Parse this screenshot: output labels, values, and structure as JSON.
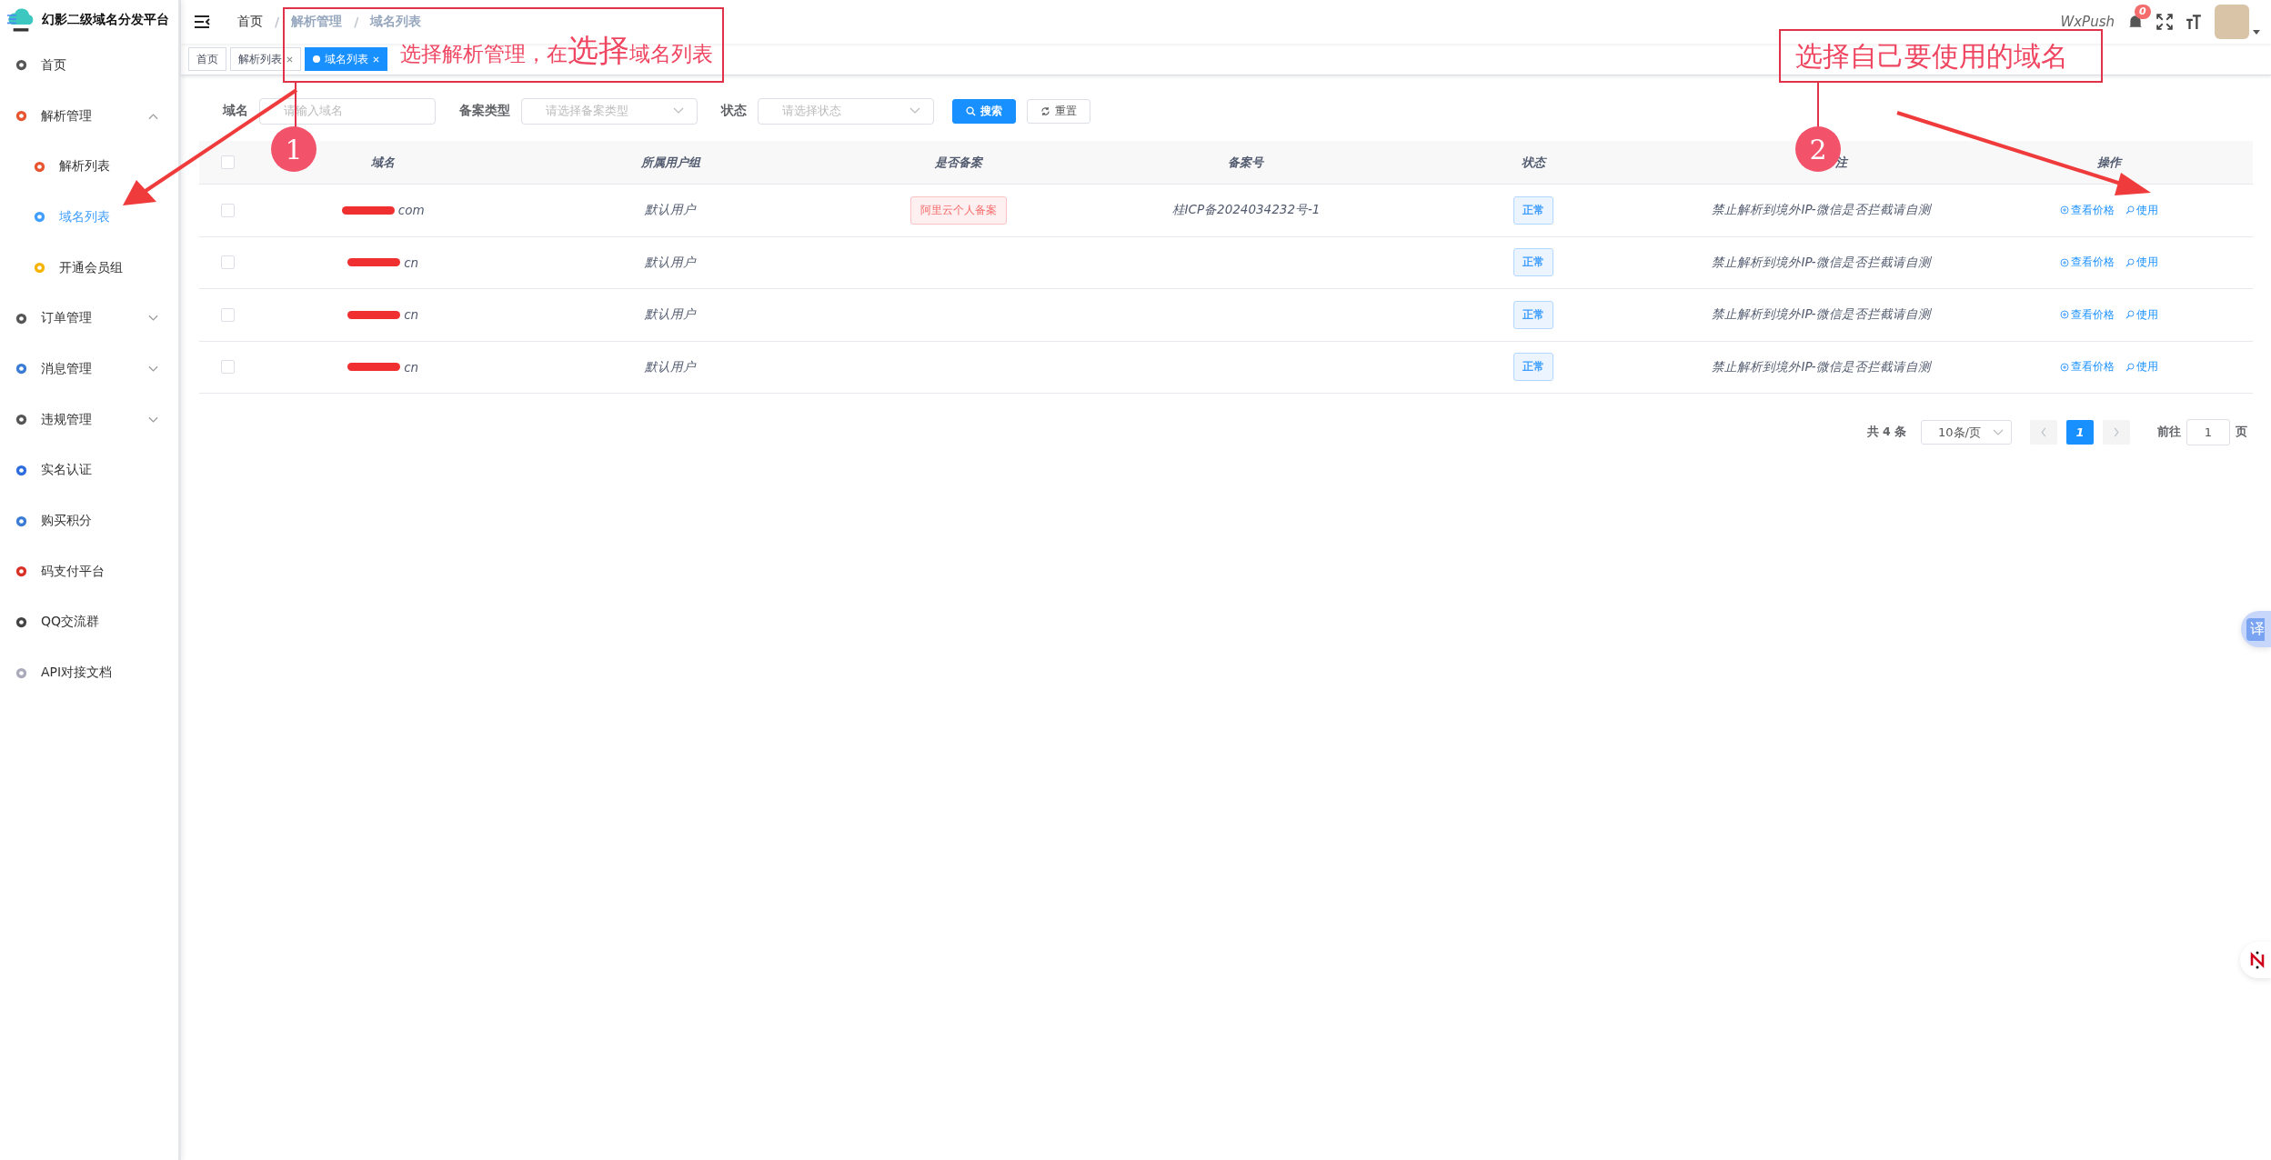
{
  "sidebar": {
    "title": "幻影二级域名分发平台",
    "items": [
      {
        "label": "首页",
        "selected": false
      },
      {
        "label": "解析管理",
        "selected": false,
        "expanded": true,
        "children": [
          {
            "label": "解析列表",
            "selected": false
          },
          {
            "label": "域名列表",
            "selected": true
          },
          {
            "label": "开通会员组",
            "selected": false
          }
        ]
      },
      {
        "label": "订单管理",
        "selected": false,
        "expanded": false
      },
      {
        "label": "消息管理",
        "selected": false,
        "expanded": false
      },
      {
        "label": "违规管理",
        "selected": false,
        "expanded": false
      },
      {
        "label": "实名认证",
        "selected": false
      },
      {
        "label": "购买积分",
        "selected": false
      },
      {
        "label": "码支付平台",
        "selected": false
      },
      {
        "label": "QQ交流群",
        "selected": false
      },
      {
        "label": "API对接文档",
        "selected": false
      }
    ]
  },
  "header": {
    "breadcrumb": [
      "首页",
      "解析管理",
      "域名列表"
    ],
    "separator": "/",
    "app_label": "WxPush",
    "notification_count": "0"
  },
  "tabs": [
    {
      "label": "首页",
      "selected": false,
      "closable": false
    },
    {
      "label": "解析列表",
      "selected": false,
      "closable": true
    },
    {
      "label": "域名列表",
      "selected": true,
      "closable": true
    }
  ],
  "filters": [
    {
      "label": "域名",
      "placeholder": "请输入域名",
      "kind": "input"
    },
    {
      "label": "备案类型",
      "placeholder": "请选择备案类型",
      "kind": "select"
    },
    {
      "label": "状态",
      "placeholder": "请选择状态",
      "kind": "select"
    }
  ],
  "filter_buttons": [
    {
      "label": "搜索",
      "kind": "primary"
    },
    {
      "label": "重置",
      "kind": "plain"
    }
  ],
  "table": {
    "select_all_checked": false,
    "columns": [
      "域名",
      "所属用户组",
      "是否备案",
      "备案号",
      "状态",
      "注",
      "操作"
    ],
    "rows": [
      {
        "checked": false,
        "domain": "com",
        "group": "默认用户",
        "filing": "阿里云个人备案",
        "filing_number": "桂ICP备2024034232号-1",
        "status": "正常",
        "remark": "禁止解析到境外IP-微信是否拦截请自测",
        "actions": [
          "查看价格",
          "使用"
        ]
      },
      {
        "checked": false,
        "domain": "cn",
        "group": "默认用户",
        "status": "正常",
        "remark": "禁止解析到境外IP-微信是否拦截请自测",
        "actions": [
          "查看价格",
          "使用"
        ]
      },
      {
        "checked": false,
        "domain": "cn",
        "group": "默认用户",
        "status": "正常",
        "remark": "禁止解析到境外IP-微信是否拦截请自测",
        "actions": [
          "查看价格",
          "使用"
        ]
      },
      {
        "checked": false,
        "domain": "cn",
        "group": "默认用户",
        "status": "正常",
        "remark": "禁止解析到境外IP-微信是否拦截请自测",
        "actions": [
          "查看价格",
          "使用"
        ]
      }
    ]
  },
  "pagination": {
    "total": "共 4 条",
    "page_size": "10条/页",
    "pages": [
      {
        "label": "1",
        "selected": true
      }
    ],
    "prev_disabled": true,
    "next_disabled": true,
    "goto_label": "前往",
    "goto_value": "1",
    "goto_suffix": "页"
  },
  "floating": {
    "translate_label": "译"
  },
  "annotations": [
    {
      "number": "1",
      "parts": [
        {
          "text": "选择解析管理，在",
          "large": false
        },
        {
          "text": "选择",
          "large": true
        },
        {
          "text": "域名列表",
          "large": false
        }
      ]
    },
    {
      "number": "2",
      "parts": [
        {
          "text": "选择自己要使用的域名",
          "large": false
        }
      ]
    }
  ]
}
